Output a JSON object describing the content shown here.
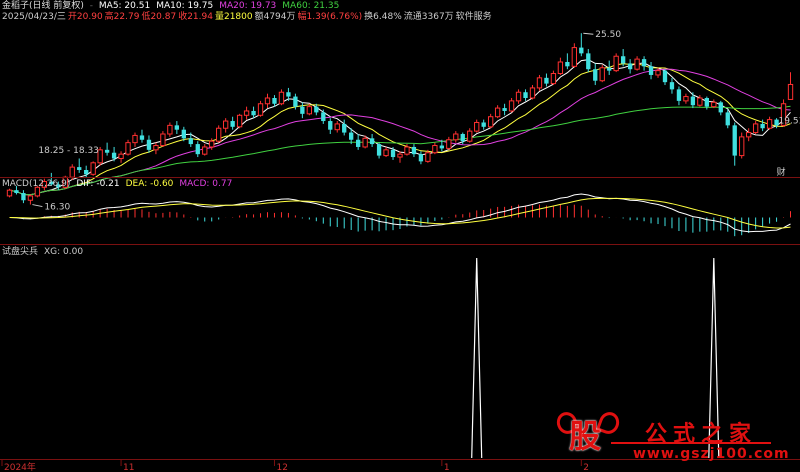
{
  "header": {
    "title": "金稻子(日线 前复权)",
    "ma_items": [
      {
        "text": "MA5: 20.51",
        "color": "#ffffff"
      },
      {
        "text": "MA10: 19.75",
        "color": "#ffffff"
      },
      {
        "text": "MA20: 19.73",
        "color": "#e040e0"
      },
      {
        "text": "MA60: 21.35",
        "color": "#40d040"
      }
    ],
    "info_items": [
      {
        "text": "2025/04/23/三",
        "color": "#cccccc"
      },
      {
        "text": "开20.90",
        "color": "#ff4040"
      },
      {
        "text": "高22.79",
        "color": "#ff4040"
      },
      {
        "text": "低20.87",
        "color": "#ff4040"
      },
      {
        "text": "收21.94",
        "color": "#ff4040"
      },
      {
        "text": "量21800",
        "color": "#ffff40"
      },
      {
        "text": "额4794万",
        "color": "#cccccc"
      },
      {
        "text": "幅1.39(6.76%)",
        "color": "#ff4040"
      },
      {
        "text": "换6.48%",
        "color": "#cccccc"
      },
      {
        "text": "流通3367万",
        "color": "#cccccc"
      },
      {
        "text": "软件服务",
        "color": "#cccccc"
      }
    ]
  },
  "macd_header": [
    {
      "text": "MACD(12,26,9)",
      "color": "#cccccc"
    },
    {
      "text": "DIF: -0.21",
      "color": "#ffffff"
    },
    {
      "text": "DEA: -0.60",
      "color": "#ffff40"
    },
    {
      "text": "MACD: 0.77",
      "color": "#e040e0"
    }
  ],
  "xg_header": [
    {
      "text": "试盘尖兵",
      "color": "#cccccc"
    },
    {
      "text": "XG: 0.00",
      "color": "#cccccc"
    }
  ],
  "annotations": {
    "high": "25.50",
    "low": "16.30",
    "range": "18.25 - 18.33",
    "last": "19.51",
    "fin": "财"
  },
  "watermark": {
    "gu": "股",
    "title": "公式之家",
    "url": "www.gszj100.com"
  },
  "chart_data": [
    {
      "type": "candlestick",
      "title": "金稻子(日线 前复权)",
      "candles": [
        [
          14.2,
          14.7,
          14.1,
          14.6
        ],
        [
          14.6,
          14.9,
          14.3,
          14.4
        ],
        [
          14.4,
          14.6,
          13.7,
          13.9
        ],
        [
          13.9,
          14.3,
          13.6,
          14.2
        ],
        [
          14.2,
          14.9,
          14.1,
          14.8
        ],
        [
          14.8,
          15.4,
          14.6,
          15.2
        ],
        [
          15.2,
          15.8,
          14.9,
          15.0
        ],
        [
          15.0,
          15.2,
          14.6,
          14.8
        ],
        [
          14.8,
          15.6,
          14.7,
          15.5
        ],
        [
          15.5,
          16.4,
          15.3,
          16.2
        ],
        [
          16.2,
          16.8,
          15.8,
          16.0
        ],
        [
          16.0,
          16.3,
          15.5,
          15.7
        ],
        [
          15.7,
          16.6,
          15.6,
          16.5
        ],
        [
          16.5,
          17.6,
          16.3,
          17.4
        ],
        [
          17.4,
          17.9,
          17.0,
          17.2
        ],
        [
          17.2,
          17.6,
          16.6,
          16.8
        ],
        [
          16.8,
          17.3,
          16.5,
          17.1
        ],
        [
          17.1,
          18.1,
          17.0,
          17.9
        ],
        [
          17.9,
          18.6,
          17.6,
          18.4
        ],
        [
          18.4,
          18.8,
          17.9,
          18.1
        ],
        [
          18.1,
          18.4,
          17.2,
          17.4
        ],
        [
          17.4,
          17.9,
          17.1,
          17.7
        ],
        [
          17.7,
          18.7,
          17.6,
          18.5
        ],
        [
          18.5,
          19.3,
          18.3,
          19.1
        ],
        [
          19.1,
          19.4,
          18.5,
          18.8
        ],
        [
          18.8,
          19.0,
          18.0,
          18.2
        ],
        [
          18.2,
          18.6,
          17.6,
          17.8
        ],
        [
          17.8,
          18.0,
          16.9,
          17.1
        ],
        [
          17.1,
          17.8,
          17.0,
          17.6
        ],
        [
          17.6,
          18.2,
          17.4,
          18.0
        ],
        [
          18.0,
          19.1,
          17.9,
          18.9
        ],
        [
          18.9,
          19.6,
          18.6,
          19.4
        ],
        [
          19.4,
          19.7,
          18.8,
          19.0
        ],
        [
          19.0,
          19.9,
          18.9,
          19.8
        ],
        [
          19.8,
          20.4,
          19.5,
          20.1
        ],
        [
          20.1,
          20.4,
          19.6,
          19.8
        ],
        [
          19.8,
          20.8,
          19.7,
          20.6
        ],
        [
          20.6,
          21.3,
          20.3,
          21.0
        ],
        [
          21.0,
          21.2,
          20.4,
          20.6
        ],
        [
          20.6,
          21.6,
          20.5,
          21.4
        ],
        [
          21.4,
          21.7,
          20.8,
          21.1
        ],
        [
          21.1,
          21.3,
          20.2,
          20.4
        ],
        [
          20.4,
          20.7,
          19.6,
          19.9
        ],
        [
          19.9,
          20.6,
          19.8,
          20.4
        ],
        [
          20.4,
          20.6,
          19.8,
          20.0
        ],
        [
          20.0,
          20.2,
          19.2,
          19.4
        ],
        [
          19.4,
          19.6,
          18.5,
          18.8
        ],
        [
          18.8,
          19.4,
          18.6,
          19.2
        ],
        [
          19.2,
          19.5,
          18.4,
          18.6
        ],
        [
          18.6,
          18.9,
          17.8,
          18.1
        ],
        [
          18.1,
          18.5,
          17.4,
          17.6
        ],
        [
          17.6,
          18.4,
          17.5,
          18.2
        ],
        [
          18.2,
          18.5,
          17.6,
          17.8
        ],
        [
          17.8,
          17.9,
          16.8,
          17.0
        ],
        [
          17.0,
          17.6,
          16.9,
          17.4
        ],
        [
          17.4,
          17.6,
          16.7,
          16.9
        ],
        [
          16.9,
          17.3,
          16.5,
          17.1
        ],
        [
          17.1,
          17.8,
          17.0,
          17.6
        ],
        [
          17.6,
          17.8,
          16.9,
          17.1
        ],
        [
          17.1,
          17.3,
          16.4,
          16.6
        ],
        [
          16.6,
          17.4,
          16.5,
          17.2
        ],
        [
          17.2,
          17.9,
          17.1,
          17.7
        ],
        [
          17.7,
          18.1,
          17.3,
          17.5
        ],
        [
          17.5,
          18.3,
          17.4,
          18.1
        ],
        [
          18.1,
          18.7,
          17.9,
          18.5
        ],
        [
          18.5,
          18.6,
          17.8,
          18.0
        ],
        [
          18.0,
          18.9,
          17.9,
          18.7
        ],
        [
          18.7,
          19.5,
          18.6,
          19.3
        ],
        [
          19.3,
          19.5,
          18.8,
          19.0
        ],
        [
          19.0,
          19.9,
          18.9,
          19.7
        ],
        [
          19.7,
          20.5,
          19.6,
          20.3
        ],
        [
          20.3,
          20.6,
          19.8,
          20.1
        ],
        [
          20.1,
          21.0,
          20.0,
          20.8
        ],
        [
          20.8,
          21.6,
          20.6,
          21.4
        ],
        [
          21.4,
          21.6,
          20.8,
          21.0
        ],
        [
          21.0,
          21.9,
          20.9,
          21.7
        ],
        [
          21.7,
          22.6,
          21.5,
          22.4
        ],
        [
          22.4,
          22.7,
          21.8,
          22.0
        ],
        [
          22.0,
          22.9,
          21.9,
          22.7
        ],
        [
          22.7,
          23.8,
          22.6,
          23.5
        ],
        [
          23.5,
          24.1,
          23.0,
          23.2
        ],
        [
          23.2,
          24.8,
          23.1,
          24.5
        ],
        [
          24.5,
          25.5,
          23.9,
          24.1
        ],
        [
          24.1,
          24.4,
          22.8,
          23.0
        ],
        [
          23.0,
          23.4,
          21.9,
          22.2
        ],
        [
          22.2,
          23.3,
          22.1,
          23.1
        ],
        [
          23.1,
          23.6,
          22.6,
          22.9
        ],
        [
          22.9,
          24.1,
          22.8,
          23.9
        ],
        [
          23.9,
          24.4,
          23.2,
          23.4
        ],
        [
          23.4,
          23.7,
          22.7,
          23.0
        ],
        [
          23.0,
          23.9,
          22.9,
          23.7
        ],
        [
          23.7,
          23.9,
          22.9,
          23.2
        ],
        [
          23.2,
          23.5,
          22.3,
          22.6
        ],
        [
          22.6,
          23.1,
          22.4,
          22.9
        ],
        [
          22.9,
          23.0,
          21.9,
          22.1
        ],
        [
          22.1,
          22.4,
          21.3,
          21.6
        ],
        [
          21.6,
          21.8,
          20.5,
          20.8
        ],
        [
          20.8,
          21.3,
          20.6,
          21.1
        ],
        [
          21.1,
          21.4,
          20.3,
          20.5
        ],
        [
          20.5,
          21.2,
          20.4,
          21.0
        ],
        [
          21.0,
          21.1,
          20.2,
          20.4
        ],
        [
          20.4,
          20.9,
          20.3,
          20.7
        ],
        [
          20.7,
          20.8,
          19.8,
          20.0
        ],
        [
          20.0,
          20.2,
          18.9,
          19.1
        ],
        [
          19.1,
          19.3,
          16.3,
          17.0
        ],
        [
          17.0,
          18.6,
          16.8,
          18.3
        ],
        [
          18.3,
          18.9,
          18.0,
          18.6
        ],
        [
          18.6,
          19.4,
          18.5,
          19.2
        ],
        [
          19.2,
          19.5,
          18.7,
          18.9
        ],
        [
          18.9,
          19.7,
          18.8,
          19.5
        ],
        [
          19.5,
          19.6,
          18.9,
          19.1
        ],
        [
          19.1,
          20.9,
          19.0,
          20.6
        ],
        [
          20.9,
          22.79,
          20.87,
          21.94
        ]
      ],
      "ma": [
        {
          "name": "MA5",
          "color": "#ffffff"
        },
        {
          "name": "MA10",
          "color": "#ffff40"
        },
        {
          "name": "MA20",
          "color": "#e040e0"
        },
        {
          "name": "MA60",
          "color": "#40d040"
        }
      ]
    },
    {
      "type": "bar",
      "title": "MACD(12,26,9)",
      "series": [
        {
          "name": "DIF",
          "color": "#ffffff"
        },
        {
          "name": "DEA",
          "color": "#ffff40"
        },
        {
          "name": "MACD",
          "color": "#e040e0"
        }
      ]
    },
    {
      "type": "line",
      "title": "试盘尖兵",
      "series": [
        {
          "name": "XG",
          "color": "#ffffff"
        }
      ],
      "signals": [
        67,
        101
      ]
    }
  ],
  "x_axis": {
    "labels": [
      "2024年",
      "11",
      "12",
      "1",
      "2"
    ],
    "label_index": [
      0,
      16,
      38,
      62,
      82
    ]
  }
}
